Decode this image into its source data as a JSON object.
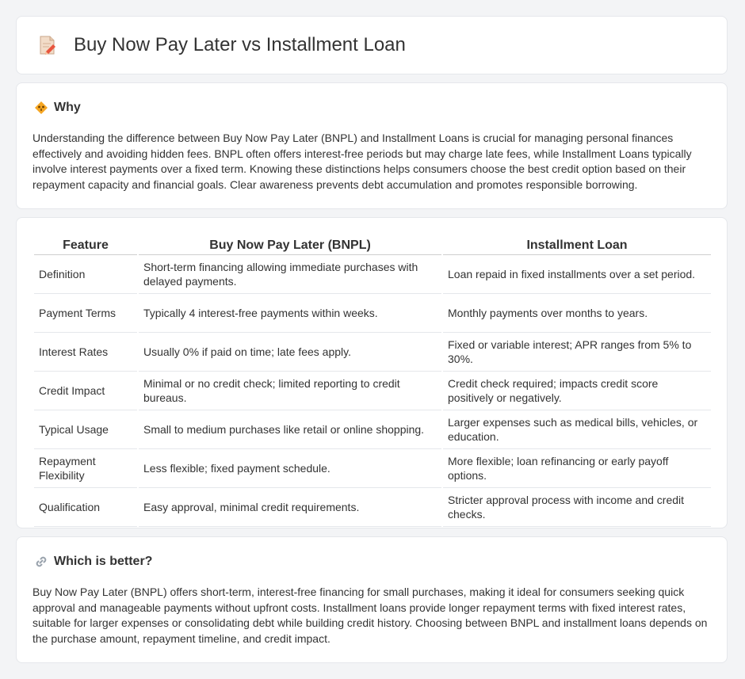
{
  "header": {
    "title": "Buy Now Pay Later vs Installment Loan",
    "icon": "document-pencil-icon"
  },
  "why": {
    "heading": "Why",
    "icon": "diamond-warning-icon",
    "body": "Understanding the difference between Buy Now Pay Later (BNPL) and Installment Loans is crucial for managing personal finances effectively and avoiding hidden fees. BNPL often offers interest-free periods but may charge late fees, while Installment Loans typically involve interest payments over a fixed term. Knowing these distinctions helps consumers choose the best credit option based on their repayment capacity and financial goals. Clear awareness prevents debt accumulation and promotes responsible borrowing."
  },
  "table": {
    "headers": [
      "Feature",
      "Buy Now Pay Later (BNPL)",
      "Installment Loan"
    ],
    "rows": [
      [
        "Definition",
        "Short-term financing allowing immediate purchases with delayed payments.",
        "Loan repaid in fixed installments over a set period."
      ],
      [
        "Payment Terms",
        "Typically 4 interest-free payments within weeks.",
        "Monthly payments over months to years."
      ],
      [
        "Interest Rates",
        "Usually 0% if paid on time; late fees apply.",
        "Fixed or variable interest; APR ranges from 5% to 30%."
      ],
      [
        "Credit Impact",
        "Minimal or no credit check; limited reporting to credit bureaus.",
        "Credit check required; impacts credit score positively or negatively."
      ],
      [
        "Typical Usage",
        "Small to medium purchases like retail or online shopping.",
        "Larger expenses such as medical bills, vehicles, or education."
      ],
      [
        "Repayment Flexibility",
        "Less flexible; fixed payment schedule.",
        "More flexible; loan refinancing or early payoff options."
      ],
      [
        "Qualification",
        "Easy approval, minimal credit requirements.",
        "Stricter approval process with income and credit checks."
      ]
    ]
  },
  "better": {
    "heading": "Which is better?",
    "icon": "link-icon",
    "body": "Buy Now Pay Later (BNPL) offers short-term, interest-free financing for small purchases, making it ideal for consumers seeking quick approval and manageable payments without upfront costs. Installment loans provide longer repayment terms with fixed interest rates, suitable for larger expenses or consolidating debt while building credit history. Choosing between BNPL and installment loans depends on the purchase amount, repayment timeline, and credit impact."
  }
}
